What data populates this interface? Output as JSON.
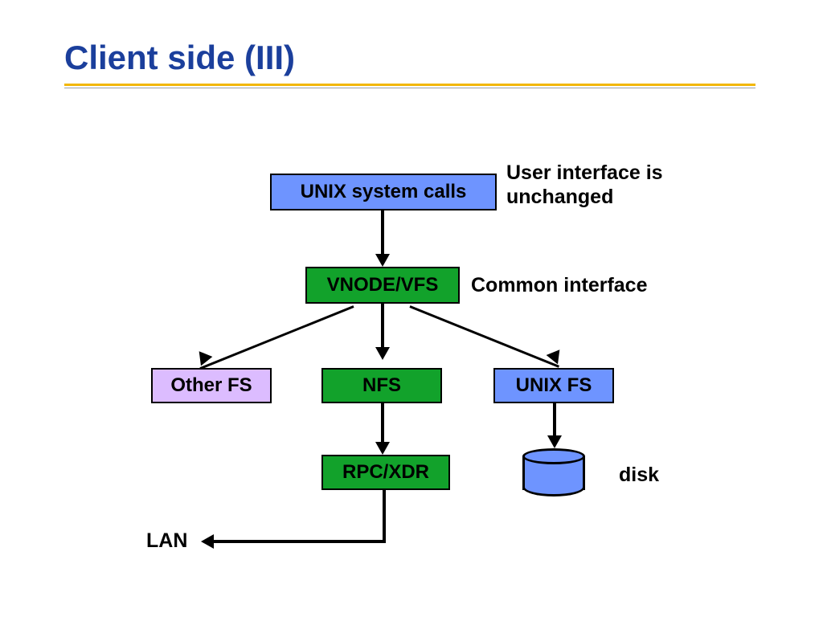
{
  "title": "Client side (III)",
  "boxes": {
    "unix_calls": "UNIX system calls",
    "vnode": "VNODE/VFS",
    "other_fs": "Other FS",
    "nfs": "NFS",
    "unix_fs": "UNIX FS",
    "rpcxdr": "RPC/XDR"
  },
  "labels": {
    "user_iface": "User interface is unchanged",
    "common_iface": "Common interface",
    "disk": "disk",
    "lan": "LAN"
  }
}
